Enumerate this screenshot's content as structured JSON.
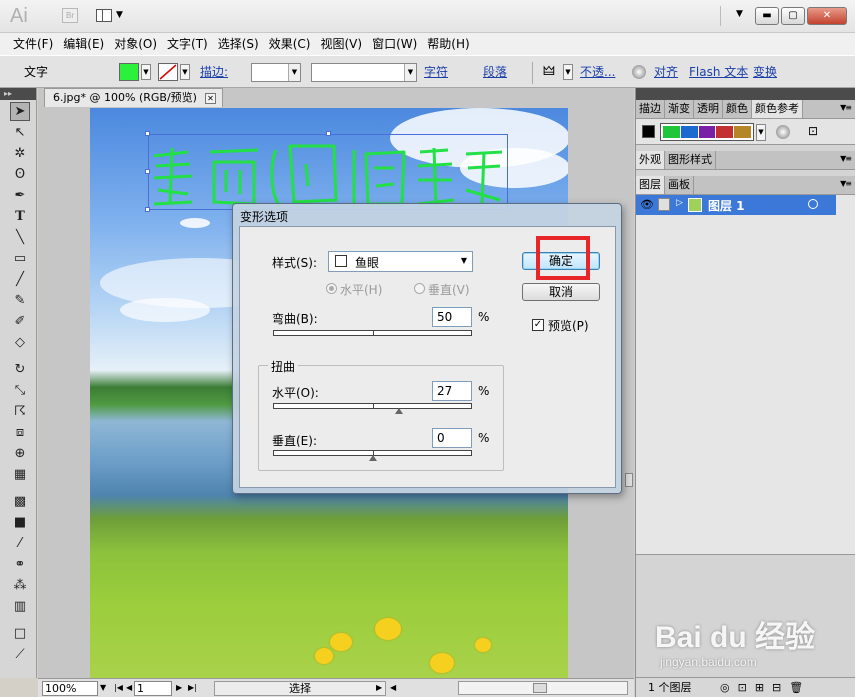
{
  "titlebar": {
    "logo": "Ai",
    "bridge_label": "Br",
    "buttons": {
      "minimize": "▬",
      "maximize": "▢",
      "close": "✕"
    },
    "icons": [
      "bridge-icon",
      "arrange-documents-icon",
      "workspace-dropdown-icon"
    ]
  },
  "menubar": {
    "items": [
      "文件(F)",
      "编辑(E)",
      "对象(O)",
      "文字(T)",
      "选择(S)",
      "效果(C)",
      "视图(V)",
      "窗口(W)",
      "帮助(H)"
    ]
  },
  "controlbar": {
    "label": "文字",
    "fill_color": "#2bf03c",
    "stroke_label": "描边:",
    "char_link": "字符",
    "para_link": "段落",
    "opacity_link": "不透...",
    "align_link": "对齐",
    "flash_link": "Flash 文本",
    "transform_link": "变换"
  },
  "document": {
    "tab_title": "6.jpg* @ 100% (RGB/预览)",
    "art_text_color": "#22e046",
    "sky_color": "#4b88de",
    "grass_color": "#9acd3c"
  },
  "statusbar": {
    "zoom": "100%",
    "artboard": "1",
    "mode": "选择"
  },
  "right_panels": {
    "top_tabs": [
      "描边",
      "渐变",
      "透明",
      "颜色",
      "颜色参考"
    ],
    "guide_colors": [
      "#1fc63a",
      "#1a6ad0",
      "#7a1fa8",
      "#c43030",
      "#b48628"
    ],
    "mid_tabs": [
      "外观",
      "图形样式"
    ],
    "layer_tabs": [
      "图层",
      "画板"
    ],
    "layer_name": "图层 1",
    "footer": "1 个图层"
  },
  "dialog": {
    "title": "变形选项",
    "style_label": "样式(S):",
    "style_value": "鱼眼",
    "horizontal_radio": "水平(H)",
    "vertical_radio": "垂直(V)",
    "bend_label": "弯曲(B):",
    "bend_value": "50",
    "percent": "%",
    "distortion_group": "扭曲",
    "dist_h_label": "水平(O):",
    "dist_h_value": "27",
    "dist_v_label": "垂直(E):",
    "dist_v_value": "0",
    "ok_button": "确定",
    "cancel_button": "取消",
    "preview_label": "预览(P)",
    "preview_checked": true,
    "bend_fraction": 0.5,
    "dist_h_fraction": 0.635,
    "dist_v_fraction": 0.5,
    "highlight_color": "#e8262a"
  },
  "watermark": {
    "text": "Bai du 经验",
    "sub": "jingyan.baidu.com"
  }
}
